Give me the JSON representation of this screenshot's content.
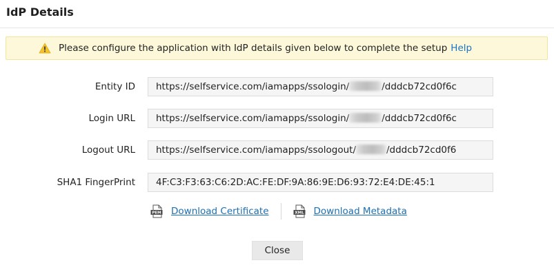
{
  "dialog": {
    "title": "IdP Details"
  },
  "banner": {
    "icon": "warning-icon",
    "message": "Please configure the application with IdP details given below to complete the setup",
    "help_link": "Help",
    "background_color": "#fdf8d9",
    "icon_color": "#f2c230"
  },
  "fields": {
    "entity_id": {
      "label": "Entity ID",
      "value_prefix": "https://selfservice.com/iamapps/ssologin/",
      "value_suffix": "/dddcb72cd0f6c"
    },
    "login_url": {
      "label": "Login URL",
      "value_prefix": "https://selfservice.com/iamapps/ssologin/",
      "value_suffix": "/dddcb72cd0f6c"
    },
    "logout_url": {
      "label": "Logout URL",
      "value_prefix": "https://selfservice.com/iamapps/ssologout/",
      "value_suffix": "/dddcb72cd0f6"
    },
    "sha1_fingerprint": {
      "label": "SHA1 FingerPrint",
      "value": "4F:C3:F3:63:C6:2D:AC:FE:DF:9A:86:9E:D6:93:72:E4:DE:45:1"
    }
  },
  "downloads": {
    "certificate": {
      "icon": "pem-file-icon",
      "icon_text": "PEM",
      "label": "Download Certificate"
    },
    "metadata": {
      "icon": "xml-file-icon",
      "icon_text": "XML",
      "label": "Download Metadata"
    }
  },
  "footer": {
    "close_label": "Close"
  },
  "colors": {
    "link": "#1a6fb5",
    "field_background": "#f5f5f5"
  }
}
